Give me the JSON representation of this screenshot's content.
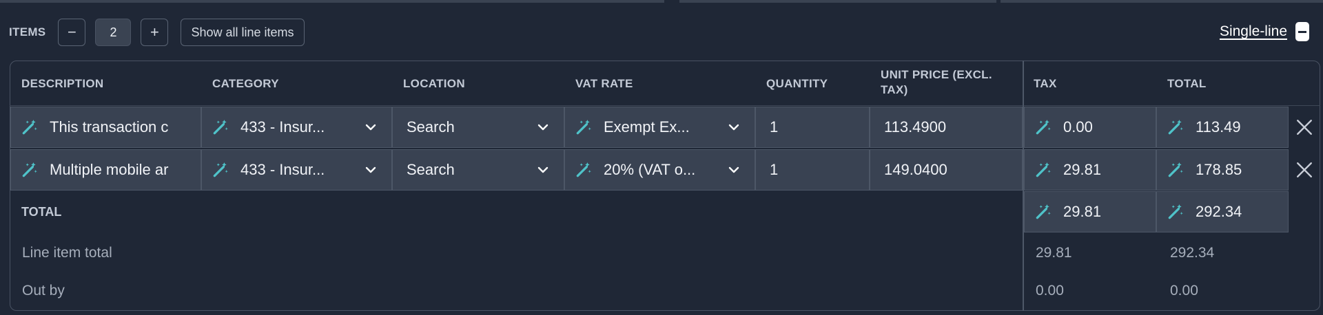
{
  "toolbar": {
    "items_label": "ITEMS",
    "decrement": "−",
    "count": "2",
    "increment": "+",
    "show_all_label": "Show all line items",
    "single_line_label": "Single-line"
  },
  "columns": {
    "description": "DESCRIPTION",
    "category": "CATEGORY",
    "location": "LOCATION",
    "vat_rate": "VAT RATE",
    "quantity": "QUANTITY",
    "unit_price_line1": "UNIT PRICE (EXCL.",
    "unit_price_line2": "TAX)",
    "tax": "TAX",
    "total": "TOTAL"
  },
  "rows": [
    {
      "description": "This transaction c",
      "category": "433 - Insur...",
      "location": "Search",
      "vat_rate": "Exempt Ex...",
      "quantity": "1",
      "unit_price": "113.4900",
      "tax": "0.00",
      "total": "113.49"
    },
    {
      "description": "Multiple mobile ar",
      "category": "433 - Insur...",
      "location": "Search",
      "vat_rate": "20% (VAT o...",
      "quantity": "1",
      "unit_price": "149.0400",
      "tax": "29.81",
      "total": "178.85"
    }
  ],
  "totals": {
    "label": "TOTAL",
    "tax": "29.81",
    "total": "292.34",
    "line_item_total_label": "Line item total",
    "line_item_tax": "29.81",
    "line_item_total": "292.34",
    "out_by_label": "Out by",
    "out_by_tax": "0.00",
    "out_by_total": "0.00"
  },
  "icons": {
    "wand": "magic-wand-icon",
    "chevron": "chevron-down-icon",
    "remove": "close-icon"
  },
  "colors": {
    "background": "#1f2736",
    "cell": "#394252",
    "wand_accent": "#4fc3c9"
  }
}
